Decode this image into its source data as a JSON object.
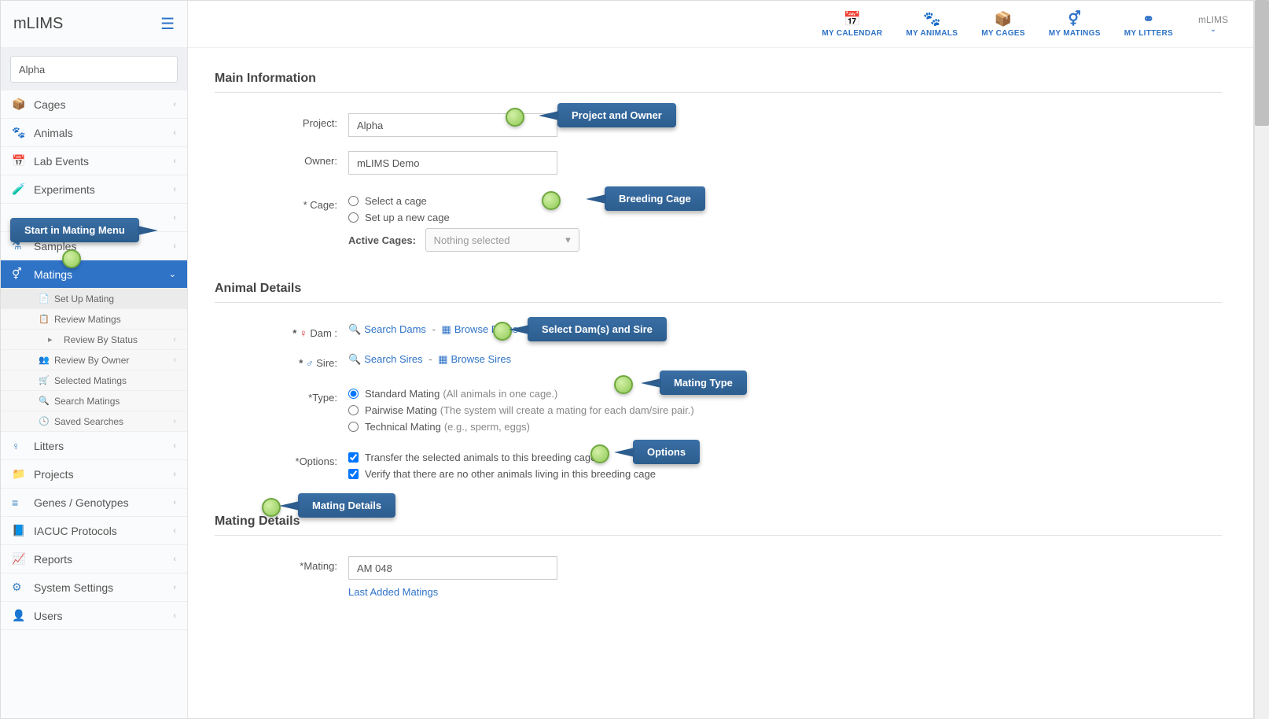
{
  "app_name": "mLIMS",
  "search_value": "Alpha",
  "topnav": [
    {
      "icon": "📅",
      "label": "MY CALENDAR"
    },
    {
      "icon": "🐾",
      "label": "MY ANIMALS"
    },
    {
      "icon": "📦",
      "label": "MY CAGES"
    },
    {
      "icon": "⚥",
      "label": "MY MATINGS"
    },
    {
      "icon": "⚭",
      "label": "MY LITTERS"
    }
  ],
  "user_label": "mLIMS",
  "sidebar": [
    {
      "icon": "📦",
      "label": "Cages"
    },
    {
      "icon": "🐾",
      "label": "Animals"
    },
    {
      "icon": "📅",
      "label": "Lab Events"
    },
    {
      "icon": "🧪",
      "label": "Experiments"
    },
    {
      "icon": "",
      "label": ""
    },
    {
      "icon": "⚗",
      "label": "Samples"
    },
    {
      "icon": "⚥",
      "label": "Matings"
    },
    {
      "icon": "♀",
      "label": "Litters"
    },
    {
      "icon": "📁",
      "label": "Projects"
    },
    {
      "icon": "≡",
      "label": "Genes / Genotypes"
    },
    {
      "icon": "📘",
      "label": "IACUC Protocols"
    },
    {
      "icon": "📈",
      "label": "Reports"
    },
    {
      "icon": "⚙",
      "label": "System Settings"
    },
    {
      "icon": "👤",
      "label": "Users"
    }
  ],
  "mating_sub": [
    {
      "icon": "📄",
      "label": "Set Up Mating"
    },
    {
      "icon": "📋",
      "label": "Review Matings"
    },
    {
      "icon": "▸",
      "label": "Review By Status",
      "indent": true,
      "chev": true
    },
    {
      "icon": "👥",
      "label": "Review By Owner",
      "chev": true
    },
    {
      "icon": "🛒",
      "label": "Selected Matings"
    },
    {
      "icon": "🔍",
      "label": "Search Matings"
    },
    {
      "icon": "🕓",
      "label": "Saved Searches",
      "chev": true
    }
  ],
  "sections": {
    "main_info": "Main Information",
    "animal_details": "Animal Details",
    "mating_details": "Mating Details"
  },
  "labels": {
    "project": "Project:",
    "owner": "Owner:",
    "cage": "* Cage:",
    "active_cages": "Active Cages:",
    "dam": "Dam :",
    "sire": "Sire:",
    "type": "*Type:",
    "options": "*Options:",
    "mating": "*Mating:"
  },
  "values": {
    "project": "Alpha",
    "owner": "mLIMS Demo",
    "cage_select": "Select a cage",
    "cage_new": "Set up a new cage",
    "active_cages_placeholder": "Nothing selected",
    "mating_id": "AM 048"
  },
  "links": {
    "search_dams": "Search Dams",
    "browse_dams": "Browse Dams",
    "search_sires": "Search Sires",
    "browse_sires": "Browse Sires",
    "last_added": "Last Added Matings"
  },
  "type_options": {
    "standard": "Standard Mating",
    "standard_hint": "(All animals in one cage.)",
    "pairwise": "Pairwise Mating",
    "pairwise_hint": "(The system will create a mating for each dam/sire pair.)",
    "technical": "Technical Mating",
    "technical_hint": "(e.g., sperm, eggs)"
  },
  "option_checks": {
    "transfer": "Transfer the selected animals to this breeding cage",
    "verify": "Verify that there are no other animals living in this breeding cage"
  },
  "callouts": {
    "start": "Start in Mating Menu",
    "project_owner": "Project and Owner",
    "breeding_cage": "Breeding Cage",
    "dam_sire": "Select Dam(s) and Sire",
    "mating_type": "Mating Type",
    "options": "Options",
    "mating_details": "Mating Details"
  }
}
